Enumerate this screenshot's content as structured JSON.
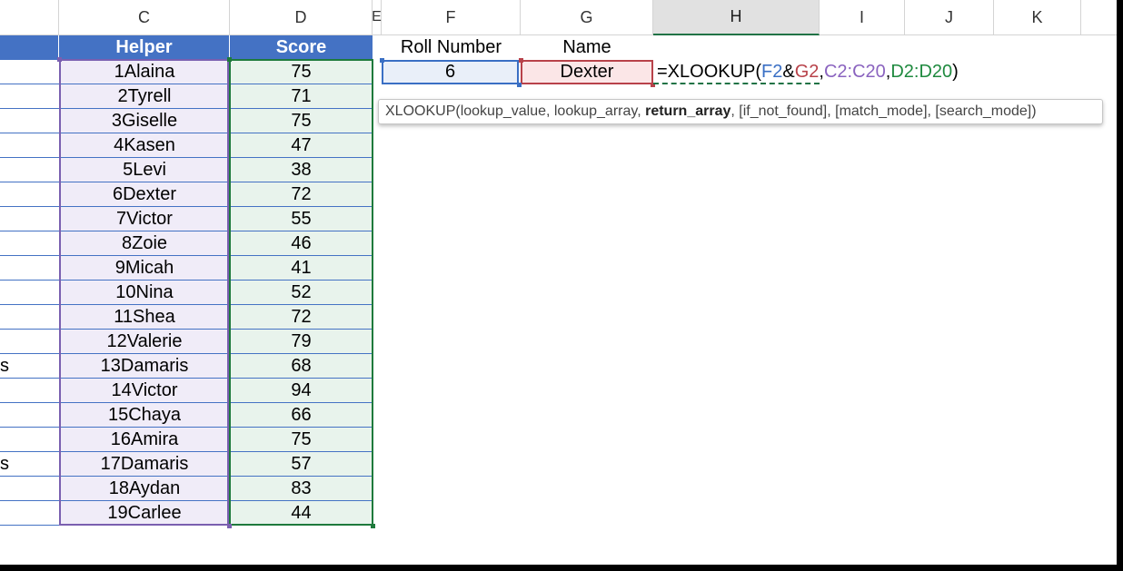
{
  "columns": [
    "C",
    "D",
    "E",
    "F",
    "G",
    "H",
    "I",
    "J",
    "K"
  ],
  "active_column": "H",
  "table": {
    "headers": {
      "helper": "Helper",
      "score": "Score"
    },
    "rows": [
      {
        "b": "",
        "helper": "1Alaina",
        "score": "75"
      },
      {
        "b": "",
        "helper": "2Tyrell",
        "score": "71"
      },
      {
        "b": "",
        "helper": "3Giselle",
        "score": "75"
      },
      {
        "b": "",
        "helper": "4Kasen",
        "score": "47"
      },
      {
        "b": "",
        "helper": "5Levi",
        "score": "38"
      },
      {
        "b": "",
        "helper": "6Dexter",
        "score": "72"
      },
      {
        "b": "",
        "helper": "7Victor",
        "score": "55"
      },
      {
        "b": "",
        "helper": "8Zoie",
        "score": "46"
      },
      {
        "b": "",
        "helper": "9Micah",
        "score": "41"
      },
      {
        "b": "",
        "helper": "10Nina",
        "score": "52"
      },
      {
        "b": "",
        "helper": "11Shea",
        "score": "72"
      },
      {
        "b": "",
        "helper": "12Valerie",
        "score": "79"
      },
      {
        "b": "s",
        "helper": "13Damaris",
        "score": "68"
      },
      {
        "b": "",
        "helper": "14Victor",
        "score": "94"
      },
      {
        "b": "",
        "helper": "15Chaya",
        "score": "66"
      },
      {
        "b": "",
        "helper": "16Amira",
        "score": "75"
      },
      {
        "b": "s",
        "helper": "17Damaris",
        "score": "57"
      },
      {
        "b": "",
        "helper": "18Aydan",
        "score": "83"
      },
      {
        "b": "",
        "helper": "19Carlee",
        "score": "44"
      }
    ]
  },
  "lookup": {
    "roll_header": "Roll Number",
    "name_header": "Name",
    "roll_value": "6",
    "name_value": "Dexter"
  },
  "formula": {
    "prefix": "=XLOOKUP(",
    "ref1": "F2",
    "amp": "&",
    "ref2": "G2",
    "sep1": ",",
    "ref3": "C2:C20",
    "sep2": ",",
    "ref4": "D2:D20",
    "suffix": ")"
  },
  "tooltip": {
    "pre": "XLOOKUP(lookup_value, lookup_array, ",
    "bold": "return_array",
    "post": ", [if_not_found], [match_mode], [search_mode])"
  },
  "colors": {
    "header_blue": "#4472c4",
    "helper_fill": "#f0ecf8",
    "score_fill": "#e8f3ec",
    "roll_fill": "#e9eff9",
    "name_fill": "#fbe6e7",
    "excel_green": "#217346"
  }
}
